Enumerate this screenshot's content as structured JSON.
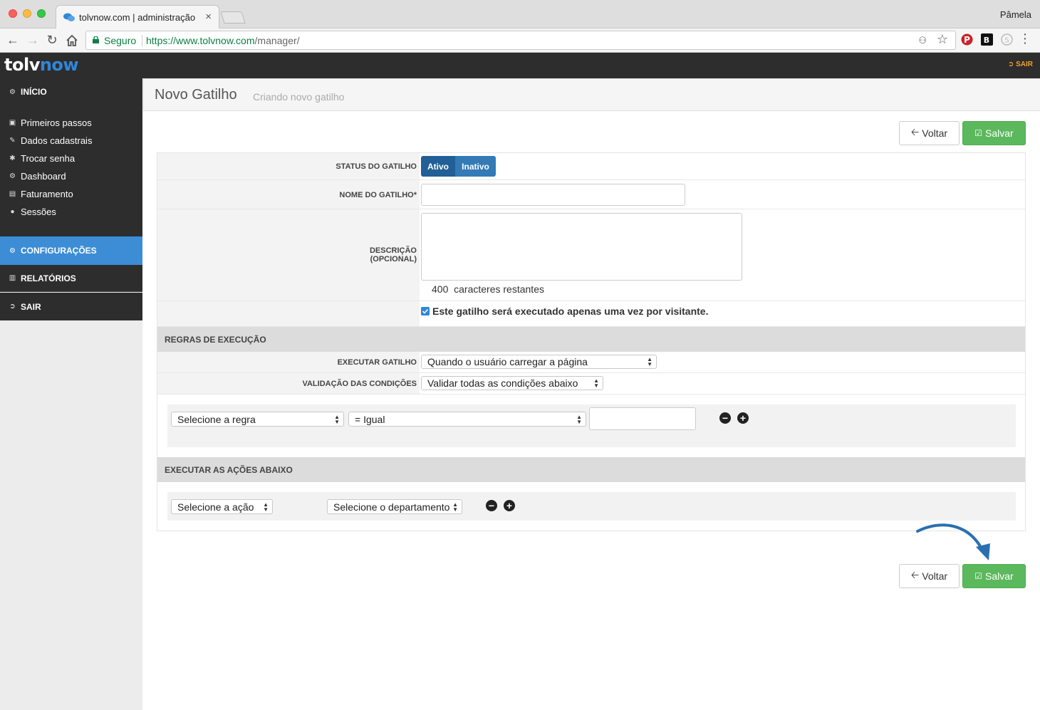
{
  "browser": {
    "tab_title": "tolvnow.com | administração",
    "tab_close": "×",
    "profile_name": "Pâmela",
    "secure_label": "Seguro",
    "url_scheme_host": "https://www.tolvnow.com",
    "url_path": "/manager/"
  },
  "header": {
    "logo_part1": "tolv",
    "logo_part2": "now",
    "logout": "SAIR"
  },
  "sidebar": {
    "home": "INÍCIO",
    "items": [
      {
        "label": "Primeiros passos",
        "icon": "briefcase-icon"
      },
      {
        "label": "Dados cadastrais",
        "icon": "edit-icon"
      },
      {
        "label": "Trocar senha",
        "icon": "asterisk-icon"
      },
      {
        "label": "Dashboard",
        "icon": "dashboard-icon"
      },
      {
        "label": "Faturamento",
        "icon": "money-icon"
      },
      {
        "label": "Sessões",
        "icon": "user-icon"
      }
    ],
    "configuracoes": "CONFIGURAÇÕES",
    "relatorios": "RELATÓRIOS",
    "sair": "SAIR"
  },
  "page": {
    "title": "Novo Gatilho",
    "subtitle": "Criando novo gatilho"
  },
  "buttons": {
    "back": "Voltar",
    "save": "Salvar"
  },
  "form": {
    "status_label": "STATUS DO GATILHO",
    "status_on": "Ativo",
    "status_off": "Inativo",
    "name_label": "NOME DO GATILHO*",
    "name_value": "",
    "desc_label_1": "DESCRIÇÃO",
    "desc_label_2": "(OPCIONAL)",
    "desc_value": "",
    "chars_count": "400",
    "chars_text": "caracteres restantes",
    "once_label": "Este gatilho será executado apenas uma vez por visitante.",
    "once_checked": true
  },
  "rules": {
    "section_title": "REGRAS DE EXECUÇÃO",
    "execute_label": "EXECUTAR GATILHO",
    "execute_value": "Quando o usuário carregar a página",
    "validation_label": "VALIDAÇÃO DAS CONDIÇÕES",
    "validation_value": "Validar todas as condições abaixo",
    "rule_select": "Selecione a regra",
    "operator_select": "= Igual",
    "rule_value": ""
  },
  "actions": {
    "section_title": "EXECUTAR AS AÇÕES ABAIXO",
    "action_select": "Selecione a ação",
    "department_select": "Selecione o departamento"
  },
  "colors": {
    "accent_blue": "#337ab7",
    "success_green": "#5cb85c",
    "dark_bar": "#2d2d2d",
    "logout_orange": "#f0a030"
  }
}
